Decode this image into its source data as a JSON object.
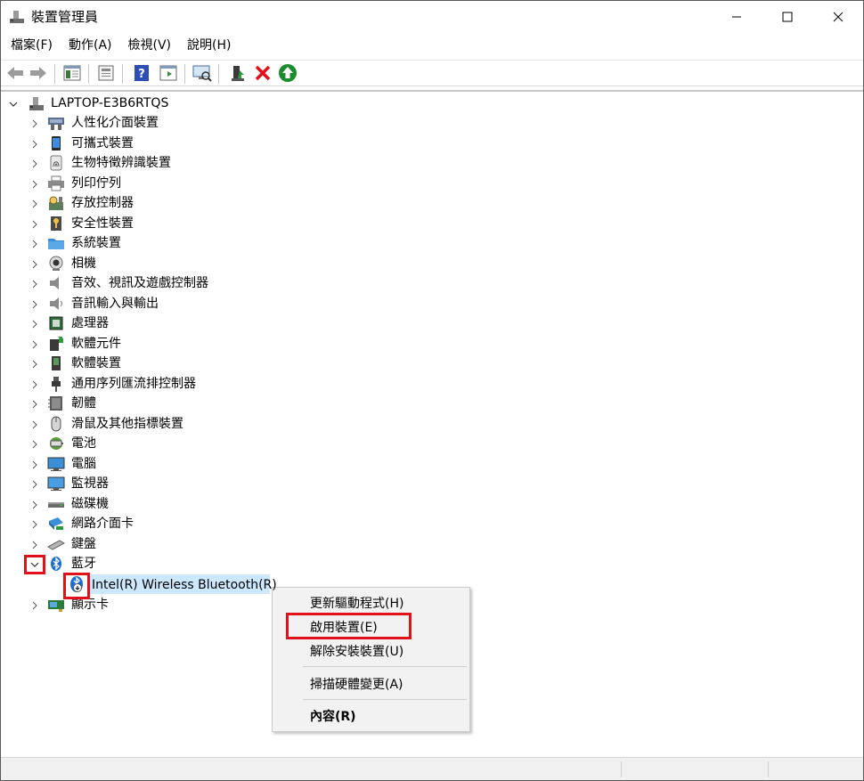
{
  "window": {
    "title": "裝置管理員"
  },
  "menu": [
    "檔案(F)",
    "動作(A)",
    "檢視(V)",
    "說明(H)"
  ],
  "toolbar": {
    "buttons": [
      "back-icon",
      "forward-icon",
      "properties-pane-icon",
      "properties-icon",
      "help-icon",
      "show-hidden-icon",
      "scan-hardware-icon",
      "update-driver-icon",
      "uninstall-icon",
      "enable-device-icon"
    ]
  },
  "tree": {
    "root": "LAPTOP-E3B6RTQS",
    "categories": [
      {
        "label": "人性化介面裝置",
        "icon": "hid-icon"
      },
      {
        "label": "可攜式裝置",
        "icon": "portable-device-icon"
      },
      {
        "label": "生物特徵辨識裝置",
        "icon": "fingerprint-icon"
      },
      {
        "label": "列印佇列",
        "icon": "printer-icon"
      },
      {
        "label": "存放控制器",
        "icon": "storage-controller-icon"
      },
      {
        "label": "安全性裝置",
        "icon": "security-device-icon"
      },
      {
        "label": "系統裝置",
        "icon": "system-device-icon"
      },
      {
        "label": "相機",
        "icon": "camera-icon"
      },
      {
        "label": "音效、視訊及遊戲控制器",
        "icon": "speaker-icon"
      },
      {
        "label": "音訊輸入與輸出",
        "icon": "audio-io-icon"
      },
      {
        "label": "處理器",
        "icon": "processor-icon"
      },
      {
        "label": "軟體元件",
        "icon": "software-component-icon"
      },
      {
        "label": "軟體裝置",
        "icon": "software-device-icon"
      },
      {
        "label": "通用序列匯流排控制器",
        "icon": "usb-icon"
      },
      {
        "label": "韌體",
        "icon": "firmware-icon"
      },
      {
        "label": "滑鼠及其他指標裝置",
        "icon": "mouse-icon"
      },
      {
        "label": "電池",
        "icon": "battery-icon"
      },
      {
        "label": "電腦",
        "icon": "computer-icon"
      },
      {
        "label": "監視器",
        "icon": "monitor-icon"
      },
      {
        "label": "磁碟機",
        "icon": "disk-drive-icon"
      },
      {
        "label": "網路介面卡",
        "icon": "network-adapter-icon"
      },
      {
        "label": "鍵盤",
        "icon": "keyboard-icon"
      },
      {
        "label": "藍牙",
        "icon": "bluetooth-icon",
        "expanded": true
      },
      {
        "label": "顯示卡",
        "icon": "display-adapter-icon"
      }
    ],
    "bluetooth_child": "Intel(R) Wireless Bluetooth(R)"
  },
  "context_menu": {
    "items": [
      "更新驅動程式(H)",
      "啟用裝置(E)",
      "解除安裝裝置(U)",
      "掃描硬體變更(A)",
      "內容(R)"
    ]
  },
  "colors": {
    "highlight": "#e2101b",
    "selection": "#cce8ff",
    "menu_bg": "#f2f2f2"
  }
}
